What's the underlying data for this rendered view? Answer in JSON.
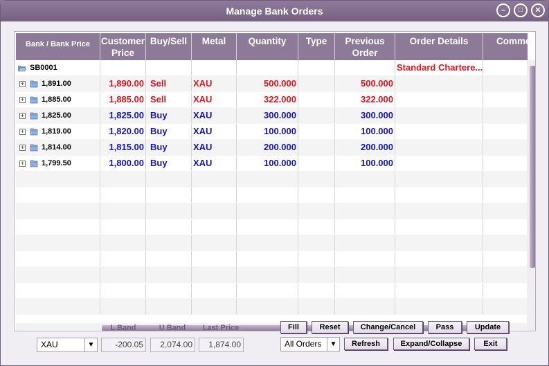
{
  "window": {
    "title": "Manage Bank Orders",
    "minimize": "–",
    "maximize": "□",
    "close": "✕"
  },
  "table": {
    "headers": [
      {
        "l1": "Bank /  Bank Price",
        "l2": ""
      },
      {
        "l1": "Customer",
        "l2": "Price"
      },
      {
        "l1": "Buy/Sell",
        "l2": ""
      },
      {
        "l1": "Metal",
        "l2": ""
      },
      {
        "l1": "Quantity",
        "l2": ""
      },
      {
        "l1": "Type",
        "l2": ""
      },
      {
        "l1": "Previous",
        "l2": "Order"
      },
      {
        "l1": "Order Details",
        "l2": ""
      },
      {
        "l1": "Comme",
        "l2": ""
      }
    ],
    "group": {
      "bank": "SB0001",
      "order_details": "Standard Chartere..."
    },
    "rows": [
      {
        "bank_price": "1,891.00",
        "customer_price": "1,890.00",
        "side": "Sell",
        "metal": "XAU",
        "quantity": "500.000",
        "type": "",
        "previous": "500.000",
        "color": "#e8121b"
      },
      {
        "bank_price": "1,885.00",
        "customer_price": "1,885.00",
        "side": "Sell",
        "metal": "XAU",
        "quantity": "322.000",
        "type": "",
        "previous": "322.000",
        "color": "#e8121b"
      },
      {
        "bank_price": "1,825.00",
        "customer_price": "1,825.00",
        "side": "Buy",
        "metal": "XAU",
        "quantity": "300.000",
        "type": "",
        "previous": "300.000",
        "color": "#1414c8"
      },
      {
        "bank_price": "1,819.00",
        "customer_price": "1,820.00",
        "side": "Buy",
        "metal": "XAU",
        "quantity": "100.000",
        "type": "",
        "previous": "100.000",
        "color": "#1414c8"
      },
      {
        "bank_price": "1,814.00",
        "customer_price": "1,815.00",
        "side": "Buy",
        "metal": "XAU",
        "quantity": "200.000",
        "type": "",
        "previous": "200.000",
        "color": "#1414c8"
      },
      {
        "bank_price": "1,799.50",
        "customer_price": "1,800.00",
        "side": "Buy",
        "metal": "XAU",
        "quantity": "100.000",
        "type": "",
        "previous": "100.000",
        "color": "#1414c8"
      }
    ]
  },
  "controls": {
    "metal_select": "XAU",
    "orders_select": "All Orders",
    "l_band_label": "L Band",
    "u_band_label": "U Band",
    "last_price_label": "Last Price",
    "l_band": "-200.05",
    "u_band": "2,074.00",
    "last_price": "1,874.00",
    "buttons": {
      "fill": "Fill",
      "reset": "Reset",
      "change_cancel": "Change/Cancel",
      "pass": "Pass",
      "update": "Update",
      "refresh": "Refresh",
      "expand_collapse": "Expand/Collapse",
      "exit": "Exit"
    }
  },
  "colors": {
    "accent": "#8d7a98",
    "sell": "#e8121b",
    "buy": "#1414c8"
  }
}
